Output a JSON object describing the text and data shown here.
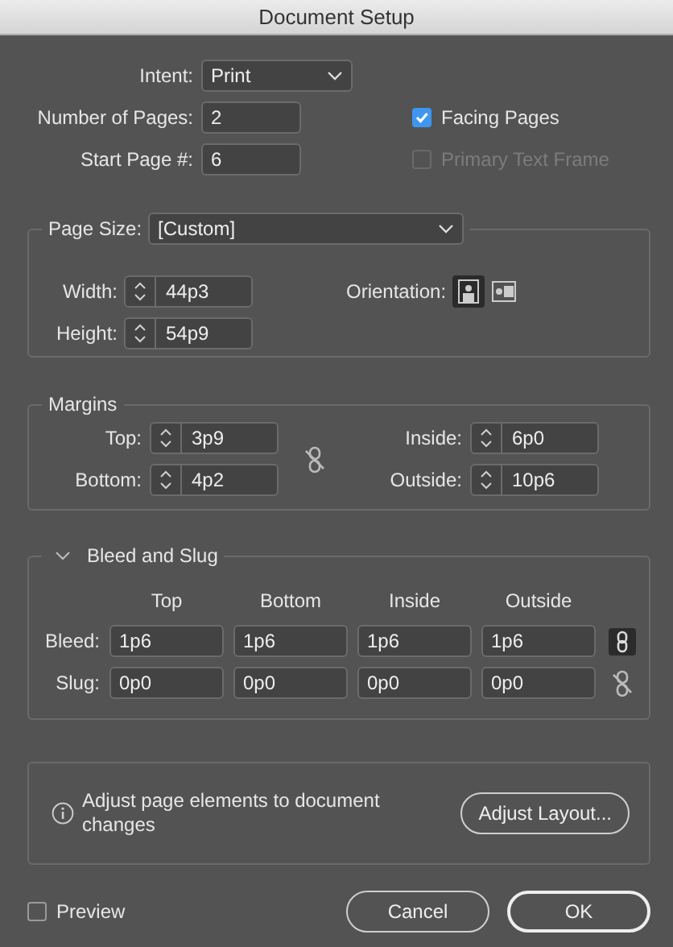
{
  "window": {
    "title": "Document Setup"
  },
  "intent": {
    "label": "Intent:",
    "value": "Print"
  },
  "number_of_pages": {
    "label": "Number of Pages:",
    "value": "2"
  },
  "start_page": {
    "label": "Start Page #:",
    "value": "6"
  },
  "options": [
    {
      "label": "Facing Pages",
      "checked": true,
      "disabled": false
    },
    {
      "label": "Primary Text Frame",
      "checked": false,
      "disabled": true
    }
  ],
  "page_size": {
    "label": "Page Size:",
    "value": "[Custom]",
    "fields": [
      {
        "label": "Width:",
        "value": "44p3"
      },
      {
        "label": "Height:",
        "value": "54p9"
      }
    ],
    "orientation": {
      "label": "Orientation:",
      "options": [
        {
          "kind": "portrait",
          "selected": true
        },
        {
          "kind": "landscape",
          "selected": false
        }
      ]
    }
  },
  "margins": {
    "title": "Margins",
    "linked": false,
    "fields": [
      {
        "label": "Top:",
        "value": "3p9"
      },
      {
        "label": "Inside:",
        "value": "6p0"
      },
      {
        "label": "Bottom:",
        "value": "4p2"
      },
      {
        "label": "Outside:",
        "value": "10p6"
      }
    ]
  },
  "bleed_and_slug": {
    "title": "Bleed and Slug",
    "expanded": true,
    "columns": [
      "Top",
      "Bottom",
      "Inside",
      "Outside"
    ],
    "rows": [
      {
        "label": "Bleed:",
        "values": [
          "1p6",
          "1p6",
          "1p6",
          "1p6"
        ],
        "linked": true
      },
      {
        "label": "Slug:",
        "values": [
          "0p0",
          "0p0",
          "0p0",
          "0p0"
        ],
        "linked": false
      }
    ]
  },
  "adjust": {
    "message": "Adjust page elements to document changes",
    "button": "Adjust Layout..."
  },
  "preview": {
    "label": "Preview",
    "checked": false
  },
  "buttons": [
    {
      "label": "Cancel",
      "default": false
    },
    {
      "label": "OK",
      "default": true
    }
  ]
}
